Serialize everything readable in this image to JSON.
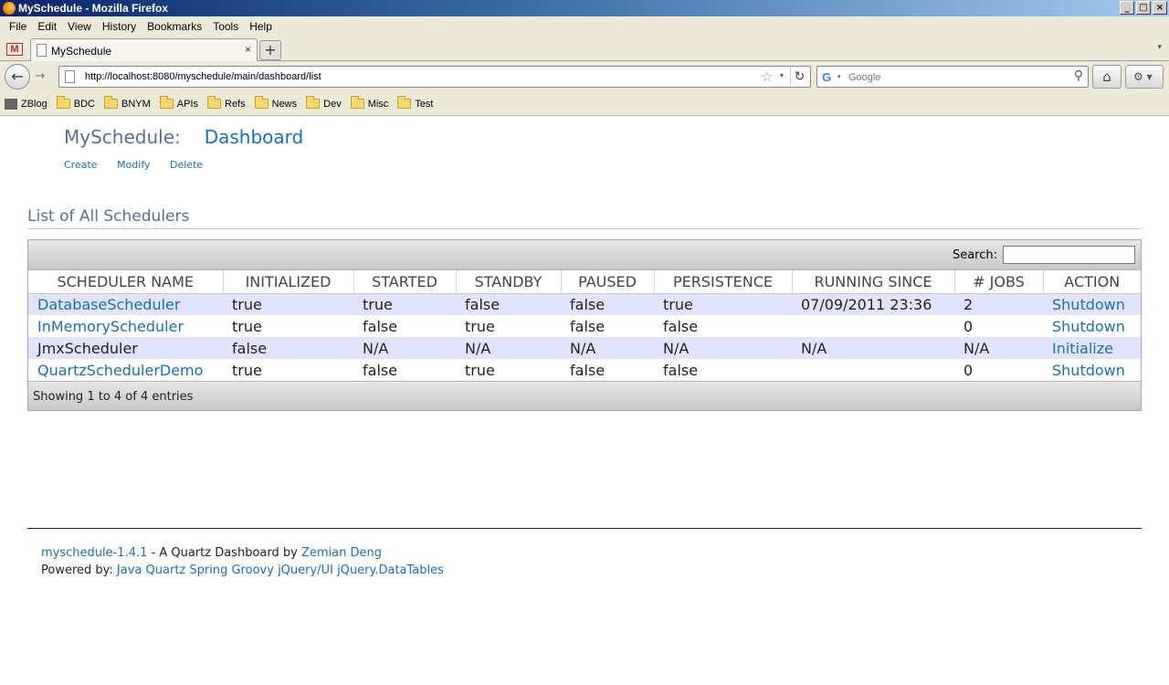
{
  "window": {
    "title": "MySchedule - Mozilla Firefox",
    "minimize": "_",
    "maximize": "□",
    "close": "×"
  },
  "menu": [
    "File",
    "Edit",
    "View",
    "History",
    "Bookmarks",
    "Tools",
    "Help"
  ],
  "tabs": {
    "active_label": "MySchedule",
    "close": "×",
    "new_tab": "+",
    "list_arrow": "▾",
    "pinned": "M"
  },
  "nav": {
    "url": "http://localhost:8080/myschedule/main/dashboard/list",
    "search_placeholder": "Google",
    "back": "←",
    "forward": "→",
    "star": "☆",
    "drop": "▾",
    "reload": "↻",
    "search_glyph": "⚲",
    "home": "⌂",
    "addon": "⚙ ▾",
    "g": "G"
  },
  "bookmarks": [
    {
      "label": "ZBlog",
      "icon": "zblog"
    },
    {
      "label": "BDC",
      "icon": "folder"
    },
    {
      "label": "BNYM",
      "icon": "folder"
    },
    {
      "label": "APIs",
      "icon": "folder"
    },
    {
      "label": "Refs",
      "icon": "folder"
    },
    {
      "label": "News",
      "icon": "folder"
    },
    {
      "label": "Dev",
      "icon": "folder"
    },
    {
      "label": "Misc",
      "icon": "folder"
    },
    {
      "label": "Test",
      "icon": "folder"
    }
  ],
  "header": {
    "app": "MySchedule:",
    "page": "Dashboard"
  },
  "actions": [
    "Create",
    "Modify",
    "Delete"
  ],
  "section_title": "List of All Schedulers",
  "table": {
    "search_label": "Search:",
    "columns": [
      "SCHEDULER NAME",
      "INITIALIZED",
      "STARTED",
      "STANDBY",
      "PAUSED",
      "PERSISTENCE",
      "RUNNING SINCE",
      "# JOBS",
      "ACTION"
    ],
    "rows": [
      {
        "name": "DatabaseScheduler",
        "name_link": true,
        "initialized": "true",
        "started": "true",
        "standby": "false",
        "paused": "false",
        "persistence": "true",
        "running_since": "07/09/2011 23:36",
        "jobs": "2",
        "action": "Shutdown"
      },
      {
        "name": "InMemoryScheduler",
        "name_link": true,
        "initialized": "true",
        "started": "false",
        "standby": "true",
        "paused": "false",
        "persistence": "false",
        "running_since": "",
        "jobs": "0",
        "action": "Shutdown"
      },
      {
        "name": "JmxScheduler",
        "name_link": false,
        "initialized": "false",
        "started": "N/A",
        "standby": "N/A",
        "paused": "N/A",
        "persistence": "N/A",
        "running_since": "N/A",
        "jobs": "N/A",
        "action": "Initialize"
      },
      {
        "name": "QuartzSchedulerDemo",
        "name_link": true,
        "initialized": "true",
        "started": "false",
        "standby": "true",
        "paused": "false",
        "persistence": "false",
        "running_since": "",
        "jobs": "0",
        "action": "Shutdown"
      }
    ],
    "info": "Showing 1 to 4 of 4 entries"
  },
  "footer": {
    "version_link": "myschedule-1.4.1",
    "by_text": " - A Quartz Dashboard by ",
    "author_link": "Zemian Deng",
    "powered_label": "Powered by: ",
    "powered_links": [
      "Java",
      "Quartz",
      "Spring",
      "Groovy",
      "jQuery/UI",
      "jQuery.DataTables"
    ]
  }
}
